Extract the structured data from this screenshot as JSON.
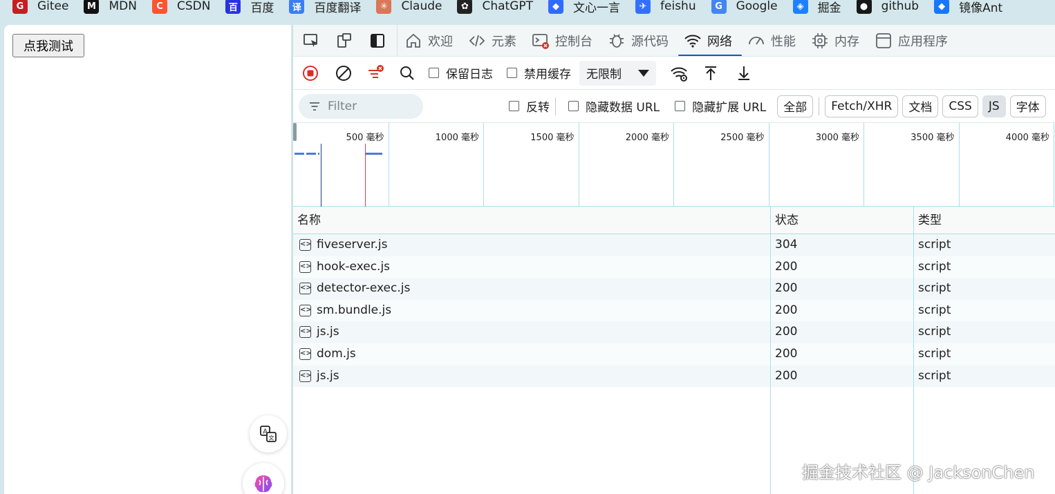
{
  "bookmarks": [
    {
      "label": "Gitee",
      "icon": "gitee-icon",
      "glyph": "G",
      "color": "#c71d23"
    },
    {
      "label": "MDN",
      "icon": "mdn-icon",
      "glyph": "M",
      "color": "#111111"
    },
    {
      "label": "CSDN",
      "icon": "csdn-icon",
      "glyph": "C",
      "color": "#fc5531"
    },
    {
      "label": "百度",
      "icon": "baidu-icon",
      "glyph": "百",
      "color": "#2932e1"
    },
    {
      "label": "百度翻译",
      "icon": "baidu-translate-icon",
      "glyph": "译",
      "color": "#3a7df5"
    },
    {
      "label": "Claude",
      "icon": "claude-icon",
      "glyph": "✳",
      "color": "#d97757"
    },
    {
      "label": "ChatGPT",
      "icon": "chatgpt-icon",
      "glyph": "✿",
      "color": "#222222"
    },
    {
      "label": "文心一言",
      "icon": "wenxin-icon",
      "glyph": "◆",
      "color": "#2f6bff"
    },
    {
      "label": "feishu",
      "icon": "feishu-icon",
      "glyph": "✈",
      "color": "#3370ff"
    },
    {
      "label": "Google",
      "icon": "google-icon",
      "glyph": "G",
      "color": "#4285f4"
    },
    {
      "label": "掘金",
      "icon": "juejin-icon",
      "glyph": "◈",
      "color": "#1e80ff"
    },
    {
      "label": "github",
      "icon": "github-icon",
      "glyph": "●",
      "color": "#181717"
    },
    {
      "label": "镜像Ant",
      "icon": "ant-icon",
      "glyph": "◆",
      "color": "#1677ff"
    }
  ],
  "page": {
    "test_button": "点我测试"
  },
  "devtools": {
    "tabs": [
      {
        "label": "欢迎",
        "icon": "home-icon"
      },
      {
        "label": "元素",
        "icon": "code-icon"
      },
      {
        "label": "控制台",
        "icon": "console-icon"
      },
      {
        "label": "源代码",
        "icon": "bug-icon"
      },
      {
        "label": "网络",
        "icon": "wifi-icon",
        "active": true
      },
      {
        "label": "性能",
        "icon": "gauge-icon"
      },
      {
        "label": "内存",
        "icon": "chip-icon"
      },
      {
        "label": "应用程序",
        "icon": "app-icon"
      }
    ],
    "toolbar": {
      "preserve_log": "保留日志",
      "disable_cache": "禁用缓存",
      "throttle": "无限制"
    },
    "filter": {
      "placeholder": "Filter",
      "invert": "反转",
      "hide_data_url": "隐藏数据 URL",
      "hide_ext_url": "隐藏扩展 URL",
      "types": [
        {
          "label": "全部",
          "selected": false
        },
        {
          "label": "Fetch/XHR",
          "selected": false
        },
        {
          "label": "文档",
          "selected": false
        },
        {
          "label": "CSS",
          "selected": false
        },
        {
          "label": "JS",
          "selected": true
        },
        {
          "label": "字体",
          "selected": false
        }
      ]
    },
    "timeline": {
      "ticks": [
        "500 毫秒",
        "1000 毫秒",
        "1500 毫秒",
        "2000 毫秒",
        "2500 毫秒",
        "3000 毫秒",
        "3500 毫秒",
        "4000 毫秒"
      ]
    },
    "table": {
      "headers": {
        "name": "名称",
        "status": "状态",
        "type": "类型"
      },
      "rows": [
        {
          "name": "fiveserver.js",
          "status": "304",
          "type": "script"
        },
        {
          "name": "hook-exec.js",
          "status": "200",
          "type": "script"
        },
        {
          "name": "detector-exec.js",
          "status": "200",
          "type": "script"
        },
        {
          "name": "sm.bundle.js",
          "status": "200",
          "type": "script"
        },
        {
          "name": "js.js",
          "status": "200",
          "type": "script"
        },
        {
          "name": "dom.js",
          "status": "200",
          "type": "script"
        },
        {
          "name": "js.js",
          "status": "200",
          "type": "script"
        }
      ]
    }
  },
  "watermark": "掘金技术社区 @ JacksonChen"
}
